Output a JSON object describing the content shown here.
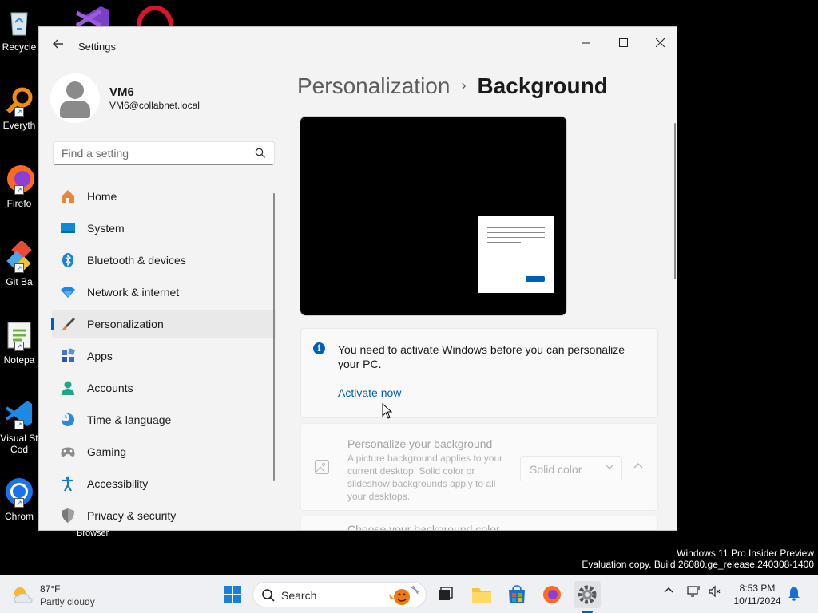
{
  "desktop": {
    "icons": [
      {
        "label": "Recycle",
        "icon": "recycle-bin-icon"
      },
      {
        "label": "Everyth",
        "icon": "everything-search-icon"
      },
      {
        "label": "Firefo",
        "icon": "firefox-icon"
      },
      {
        "label": "Git Ba",
        "icon": "git-bash-icon"
      },
      {
        "label": "Notepa",
        "icon": "notepad-plus-plus-icon"
      },
      {
        "label": "Visual St",
        "label2": "Cod",
        "icon": "vscode-icon"
      },
      {
        "label": "Chrom",
        "icon": "chrome-icon"
      }
    ],
    "behind_label": "Browser"
  },
  "window": {
    "title": "Settings",
    "controls": {
      "minimize": "—",
      "maximize": "□",
      "close": "✕"
    }
  },
  "profile": {
    "name": "VM6",
    "email": "VM6@collabnet.local"
  },
  "search": {
    "placeholder": "Find a setting"
  },
  "nav": [
    {
      "label": "Home",
      "icon": "home-icon"
    },
    {
      "label": "System",
      "icon": "system-icon"
    },
    {
      "label": "Bluetooth & devices",
      "icon": "bluetooth-icon"
    },
    {
      "label": "Network & internet",
      "icon": "wifi-icon"
    },
    {
      "label": "Personalization",
      "icon": "brush-icon",
      "active": true
    },
    {
      "label": "Apps",
      "icon": "apps-icon"
    },
    {
      "label": "Accounts",
      "icon": "accounts-icon"
    },
    {
      "label": "Time & language",
      "icon": "globe-clock-icon"
    },
    {
      "label": "Gaming",
      "icon": "gamepad-icon"
    },
    {
      "label": "Accessibility",
      "icon": "accessibility-icon"
    },
    {
      "label": "Privacy & security",
      "icon": "shield-icon"
    }
  ],
  "breadcrumb": {
    "parent": "Personalization",
    "separator": "›",
    "current": "Background"
  },
  "activation": {
    "message": "You need to activate Windows before you can personalize your PC.",
    "link": "Activate now"
  },
  "background_setting": {
    "title": "Personalize your background",
    "description": "A picture background applies to your current desktop. Solid color or slideshow backgrounds apply to all your desktops.",
    "selected": "Solid color"
  },
  "color_setting": {
    "title": "Choose your background color"
  },
  "watermark": {
    "line1": "Windows 11 Pro Insider Preview",
    "line2": "Evaluation copy. Build 26080.ge_release.240308-1400"
  },
  "taskbar": {
    "weather": {
      "temp": "87°F",
      "desc": "Partly cloudy"
    },
    "search_label": "Search",
    "clock": {
      "time": "8:53 PM",
      "date": "10/11/2024"
    }
  },
  "colors": {
    "accent": "#005fb8",
    "window_bg": "#f3f3f3"
  }
}
